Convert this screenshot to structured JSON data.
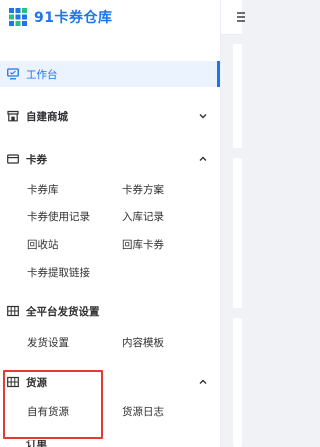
{
  "brand": {
    "name": "91卡券仓库",
    "logo_icon": "grid-logo-icon",
    "color": "#1e74ea"
  },
  "menu": {
    "workbench": {
      "label": "工作台",
      "icon": "monitor-icon",
      "active": true
    },
    "mall": {
      "label": "自建商城",
      "icon": "store-icon",
      "expanded": false
    },
    "coupons": {
      "label": "卡券",
      "icon": "card-icon",
      "expanded": true,
      "items": [
        "卡券库",
        "卡券方案",
        "卡券使用记录",
        "入库记录",
        "回收站",
        "回库卡券",
        "卡券提取链接"
      ]
    },
    "delivery": {
      "label": "全平台发货设置",
      "icon": "table-icon",
      "expanded": true,
      "items": [
        "发货设置",
        "内容模板"
      ]
    },
    "source": {
      "label": "货源",
      "icon": "table-icon",
      "expanded": true,
      "items": [
        "自有货源",
        "货源日志"
      ]
    },
    "next_label": "订单"
  },
  "colors": {
    "accent": "#1e74ea",
    "active_bg": "#eaf3ff",
    "highlight": "#e53935"
  }
}
